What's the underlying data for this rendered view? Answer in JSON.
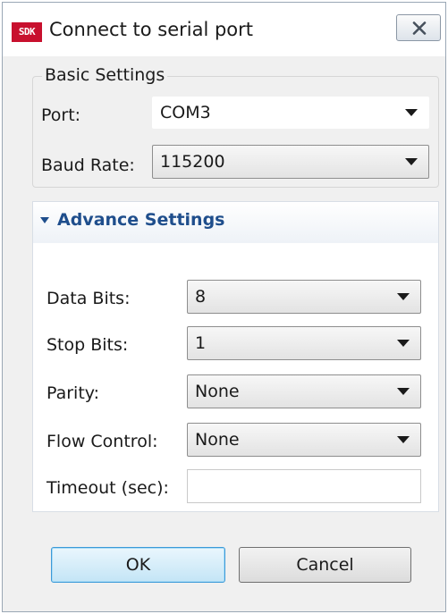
{
  "window": {
    "title": "Connect to serial port",
    "app_icon_text": "SDK",
    "close_icon": "close-x-icon"
  },
  "basic_settings": {
    "legend": "Basic Settings",
    "port_label": "Port:",
    "port_value": "COM3",
    "baud_label": "Baud Rate:",
    "baud_value": "115200"
  },
  "advance_settings": {
    "title": "Advance Settings",
    "toggle_icon": "expanded-triangle-icon",
    "data_bits_label": "Data Bits:",
    "data_bits_value": "8",
    "stop_bits_label": "Stop Bits:",
    "stop_bits_value": "1",
    "parity_label": "Parity:",
    "parity_value": "None",
    "flow_control_label": "Flow Control:",
    "flow_control_value": "None",
    "timeout_label": "Timeout (sec):",
    "timeout_value": ""
  },
  "buttons": {
    "ok_label": "OK",
    "cancel_label": "Cancel"
  },
  "colors": {
    "accent_title": "#1f4e8c",
    "app_icon_bg": "#c8102e",
    "ok_border": "#3c9ad8"
  }
}
